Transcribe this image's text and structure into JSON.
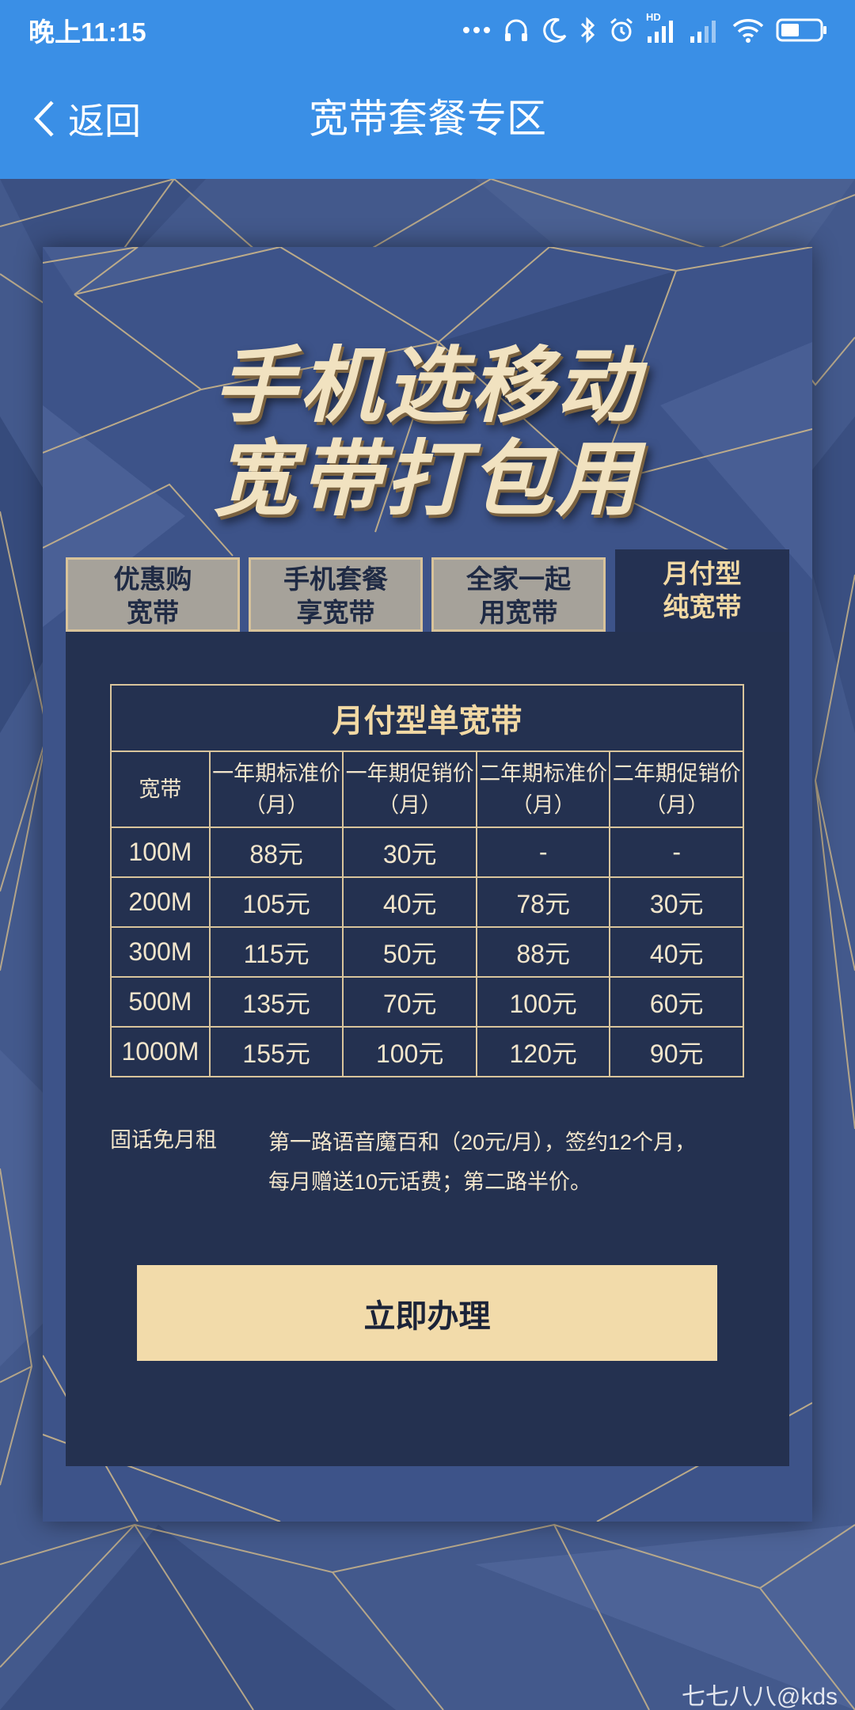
{
  "status_bar": {
    "time": "晚上11:15",
    "hd_label": "HD"
  },
  "header": {
    "back_label": "返回",
    "title": "宽带套餐专区"
  },
  "poster": {
    "headline_line1": "手机选移动",
    "headline_line2": "宽带打包用"
  },
  "tabs": [
    {
      "line1": "优惠购",
      "line2": "宽带",
      "active": false
    },
    {
      "line1": "手机套餐",
      "line2": "享宽带",
      "active": false
    },
    {
      "line1": "全家一起",
      "line2": "用宽带",
      "active": false
    },
    {
      "line1": "月付型",
      "line2": "纯宽带",
      "active": true
    }
  ],
  "price_table": {
    "title": "月付型单宽带",
    "headers": [
      "宽带",
      "一年期标准价（月）",
      "一年期促销价（月）",
      "二年期标准价（月）",
      "二年期促销价（月）"
    ],
    "rows": [
      [
        "100M",
        "88元",
        "30元",
        "-",
        "-"
      ],
      [
        "200M",
        "105元",
        "40元",
        "78元",
        "30元"
      ],
      [
        "300M",
        "115元",
        "50元",
        "88元",
        "40元"
      ],
      [
        "500M",
        "135元",
        "70元",
        "100元",
        "60元"
      ],
      [
        "1000M",
        "155元",
        "100元",
        "120元",
        "90元"
      ]
    ]
  },
  "note": {
    "label": "固话免月租",
    "text": "第一路语音魔百和（20元/月），签约12个月，每月赠送10元话费；第二路半价。"
  },
  "apply_button": "立即办理",
  "watermark": "七七八八@kds",
  "colors": {
    "header_blue": "#3a8fe6",
    "panel_navy": "#243150",
    "gold": "#f2dbaa",
    "tab_inactive": "#a6a29a"
  }
}
